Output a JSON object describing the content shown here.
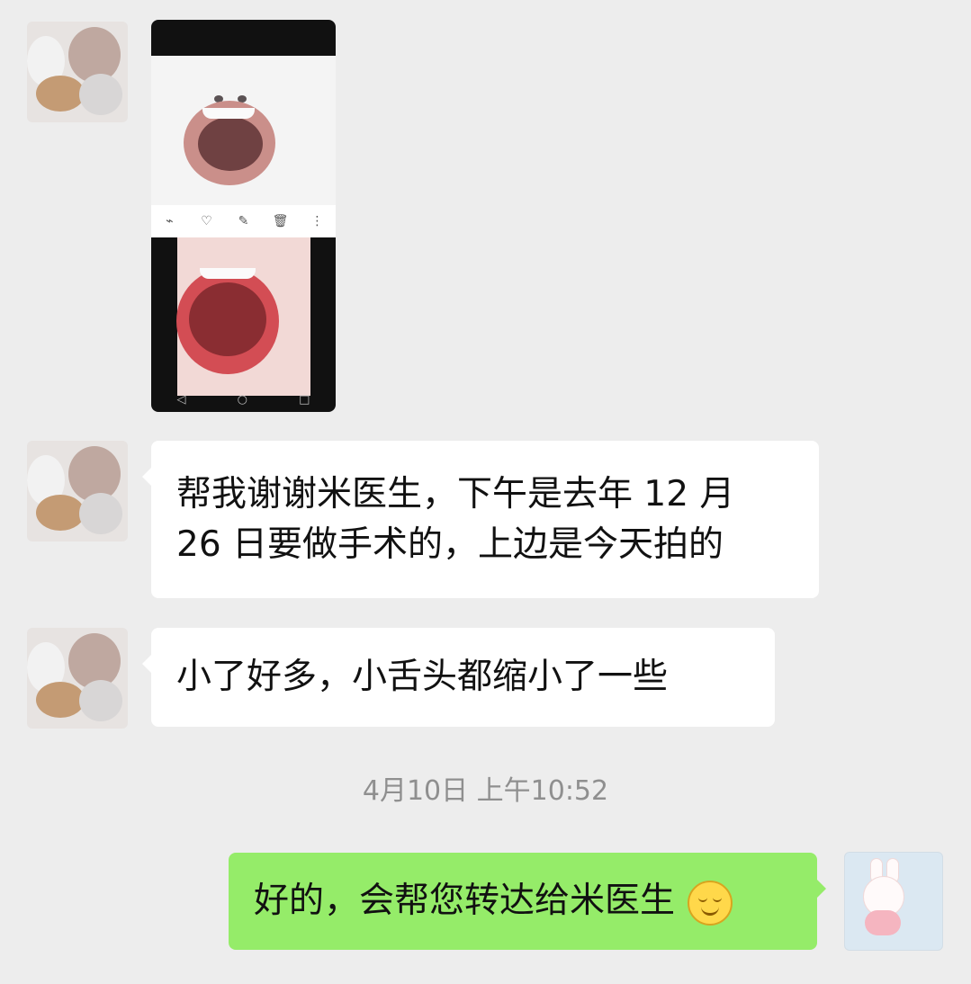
{
  "chat": {
    "messages": [
      {
        "text_lines": [
          "帮我谢谢米医生，下午是去年 12 月",
          "26 日要做手术的，上边是今天拍的"
        ]
      },
      {
        "text_lines": [
          "小了好多，小舌头都缩小了一些"
        ]
      }
    ],
    "timestamp": "4月10日 上午10:52",
    "reply": {
      "text": "好的，会帮您转达给米医生"
    }
  }
}
